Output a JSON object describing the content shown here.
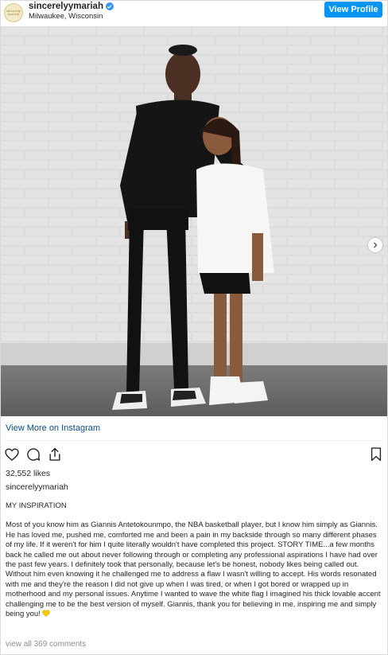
{
  "header": {
    "avatar_text": "sincerely mariah",
    "username": "sincerelyymariah",
    "location": "Milwaukee, Wisconsin",
    "view_profile_label": "View Profile"
  },
  "photo": {
    "alt": "Photo of two people posing against a white brick wall",
    "dots_total": 2,
    "dots_active_index": 0
  },
  "links": {
    "view_more_label": "View More on Instagram"
  },
  "actions": {
    "icons": [
      "heart-icon",
      "comment-icon",
      "share-icon",
      "bookmark-icon"
    ]
  },
  "stats": {
    "likes": "32,552 likes"
  },
  "caption": {
    "username": "sincerelyymariah",
    "title": "MY INSPIRATION",
    "body": "Most of you know him as Giannis Antetokounmpo, the NBA basketball player, but I know him simply as Giannis. He has loved me, pushed me, comforted me and been a pain in my backside through so many different phases of my life. If it weren't for him I quite literally wouldn't have completed this project. STORY TIME...a few months back he called me out about never following through or completing any professional aspirations I have had over the past few years. I definitely took that personally, because let's be honest, nobody likes being called out. Without him even knowing it he challenged me to address a flaw I wasn't willing to accept. His words resonated with me and they're the reason I did not give up when I was tired, or when I got bored or wrapped up in motherhood and my personal issues. Anytime I wanted to wave the white flag I imagined his thick lovable accent challenging me to be the best version of myself. Giannis, thank you for believing in me, inspiring me and simply being you!"
  },
  "comments": {
    "label": "view all 369 comments"
  },
  "colors": {
    "accent": "#0095f6",
    "verified": "#3897f0",
    "heart_emoji": "#f7c800"
  }
}
